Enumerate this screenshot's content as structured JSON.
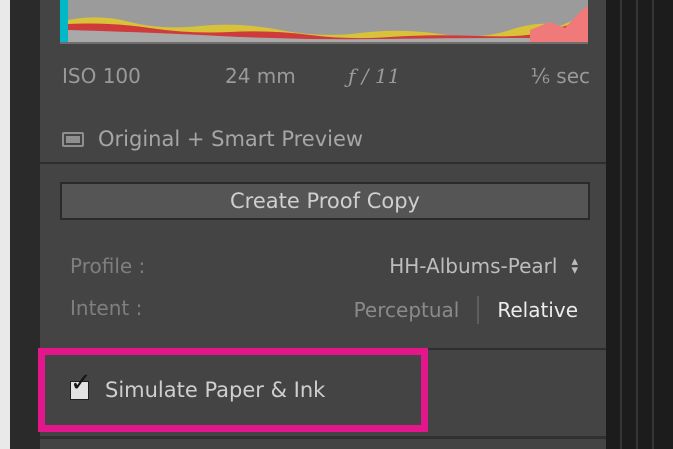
{
  "exif": {
    "iso": "ISO 100",
    "focal_length": "24 mm",
    "aperture": "ƒ / 11",
    "shutter": "⅙ sec"
  },
  "preview_status": {
    "icon": "preview-icon",
    "label": "Original + Smart Preview"
  },
  "proof": {
    "button_label": "Create Proof Copy"
  },
  "soft_proof": {
    "profile_label": "Profile :",
    "profile_value": "HH-Albums-Pearl",
    "intent_label": "Intent :",
    "intent_options": [
      "Perceptual",
      "Relative"
    ],
    "intent_selected": "Relative"
  },
  "simulate": {
    "label": "Simulate Paper & Ink",
    "checked": true
  },
  "colors": {
    "panel": "#444444",
    "highlight": "#e4168c",
    "text_active": "#ececec",
    "text_muted": "#7f7f7f"
  }
}
